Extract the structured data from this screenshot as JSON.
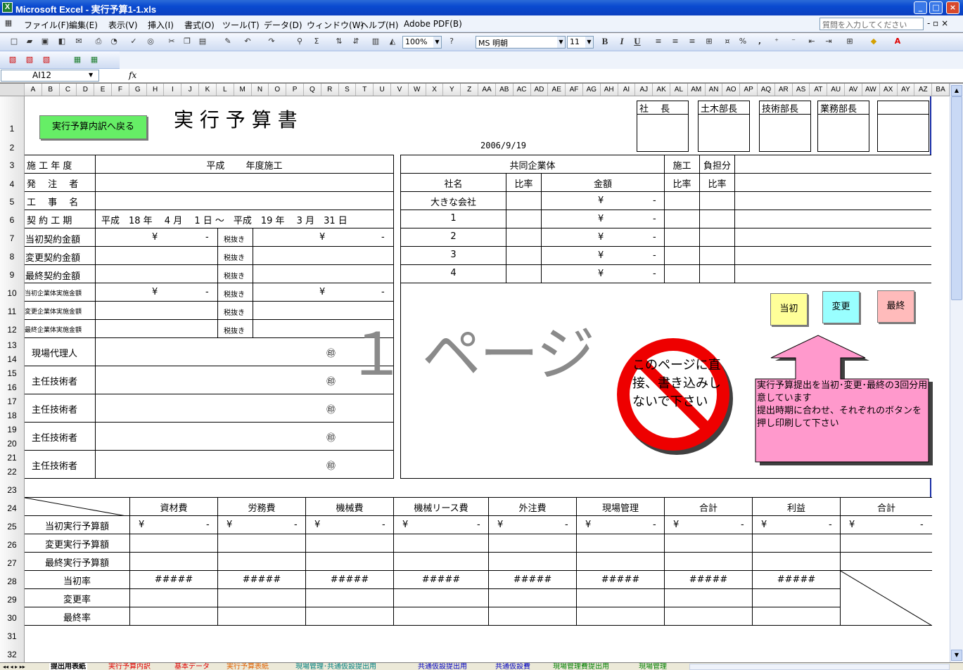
{
  "window": {
    "title": "Microsoft Excel - 実行予算1-1.xls",
    "app_icon": "X",
    "min": "_",
    "max": "□",
    "close": "×"
  },
  "menu": {
    "items": [
      "ファイル(F)",
      "編集(E)",
      "表示(V)",
      "挿入(I)",
      "書式(O)",
      "ツール(T)",
      "データ(D)",
      "ウィンドウ(W)",
      "ヘルプ(H)",
      "Adobe PDF(B)"
    ],
    "help_placeholder": "質問を入力してください",
    "doc_controls": "- ▫ ×"
  },
  "toolbar": {
    "zoom": "100%",
    "font_name": "MS 明朝",
    "font_size": "11",
    "bold": "B",
    "italic": "I",
    "underline": "U",
    "percent": "%",
    "comma": ","
  },
  "formula_bar": {
    "name_box": "AI12",
    "fx": "fx",
    "formula": ""
  },
  "columns": [
    "A",
    "B",
    "C",
    "D",
    "E",
    "F",
    "G",
    "H",
    "I",
    "J",
    "K",
    "L",
    "M",
    "N",
    "O",
    "P",
    "Q",
    "R",
    "S",
    "T",
    "U",
    "V",
    "W",
    "X",
    "Y",
    "Z",
    "AA",
    "AB",
    "AC",
    "AD",
    "AE",
    "AF",
    "AG",
    "AH",
    "AI",
    "AJ",
    "AK",
    "AL",
    "AM",
    "AN",
    "AO",
    "AP",
    "AQ",
    "AR",
    "AS",
    "AT",
    "AU",
    "AV",
    "AW",
    "AX",
    "AY",
    "AZ",
    "BA"
  ],
  "rows": [
    "1",
    "2",
    "3",
    "4",
    "5",
    "6",
    "7",
    "8",
    "9",
    "10",
    "11",
    "12",
    "13",
    "14",
    "15",
    "16",
    "17",
    "18",
    "19",
    "20",
    "21",
    "22",
    "23",
    "24",
    "25",
    "26",
    "27",
    "28",
    "29",
    "30",
    "31",
    "32"
  ],
  "sheet": {
    "back_button": "実行予算内訳へ戻る",
    "title": "実 行 予 算 書",
    "date": "2006/9/19",
    "approvals": [
      "社　 長",
      "土木部長",
      "技術部長",
      "業務部長",
      ""
    ],
    "left_labels": {
      "fiscal": "施 工 年 度",
      "fiscal_value": "平成　　 年度施工",
      "orderer": "発　 注　 者",
      "project": "工　 事　 名",
      "period": "契 約 工 期",
      "period_value": "平成　18 年　 4 月　 1 日 ～　平成　19 年　 3 月　31 日",
      "initial": "当初契約金額",
      "changed": "変更契約金額",
      "final": "最終契約金額",
      "jv_initial": "当初企業体実施金額",
      "jv_changed": "変更企業体実施金額",
      "jv_final": "最終企業体実施金額",
      "tax_excl": "税抜き",
      "yen": "¥",
      "dash": "-"
    },
    "staff": [
      {
        "role": "現場代理人",
        "seal": "㊞"
      },
      {
        "role": "主任技術者",
        "seal": "㊞"
      },
      {
        "role": "主任技術者",
        "seal": "㊞"
      },
      {
        "role": "主任技術者",
        "seal": "㊞"
      },
      {
        "role": "主任技術者",
        "seal": "㊞"
      }
    ],
    "jv": {
      "title": "共同企業体",
      "construction": "施工",
      "share": "負担分",
      "col_company": "社名",
      "col_ratio": "比率",
      "col_amount": "金額",
      "col_c_ratio": "比率",
      "col_s_ratio": "比率",
      "rows": [
        {
          "name": "大きな会社",
          "yen": "¥",
          "dash": "-"
        },
        {
          "name": "1",
          "yen": "¥",
          "dash": "-"
        },
        {
          "name": "2",
          "yen": "¥",
          "dash": "-"
        },
        {
          "name": "3",
          "yen": "¥",
          "dash": "-"
        },
        {
          "name": "4",
          "yen": "¥",
          "dash": "-"
        }
      ]
    },
    "buttons": {
      "initial": "当初",
      "change": "変更",
      "final": "最終"
    },
    "page_label": "１ ページ",
    "no_write": "このページに直接、書き込みしないで下さい",
    "note": "実行予算提出を当初･変更･最終の3回分用意しています\n提出時期に合わせ、それぞれのボタンを押し印刷して下さい",
    "budget": {
      "headers": [
        "資材費",
        "労務費",
        "機械費",
        "機械リース費",
        "外注費",
        "現場管理",
        "合計",
        "利益",
        "合計"
      ],
      "rows": [
        "当初実行予算額",
        "変更実行予算額",
        "最終実行予算額",
        "当初率",
        "変更率",
        "最終率"
      ],
      "yen": "¥",
      "dash": "-",
      "hash": "#####"
    }
  },
  "tabs": [
    {
      "label": "提出用表紙",
      "color": "#000000"
    },
    {
      "label": "実行予算内訳",
      "color": "#e00000"
    },
    {
      "label": "基本データ",
      "color": "#e00000"
    },
    {
      "label": "実行予算表紙",
      "color": "#e06000"
    },
    {
      "label": "現場管理･共通仮設提出用",
      "color": "#008080"
    },
    {
      "label": "共通仮設提出用",
      "color": "#0000c0"
    },
    {
      "label": "共通仮設費",
      "color": "#0000c0"
    },
    {
      "label": "現場管理費提出用",
      "color": "#008000"
    },
    {
      "label": "現場管理",
      "color": "#008000"
    }
  ],
  "colors": {
    "title_bg": "#0a4ad0",
    "sheet_border": "#1a2fa8",
    "btn_back": "#66ee66",
    "btn_initial": "#ffff99",
    "btn_change": "#99ffff",
    "btn_final": "#ffbbbb",
    "note_bg": "#ff99cc",
    "no_sign": "#ee0000"
  }
}
